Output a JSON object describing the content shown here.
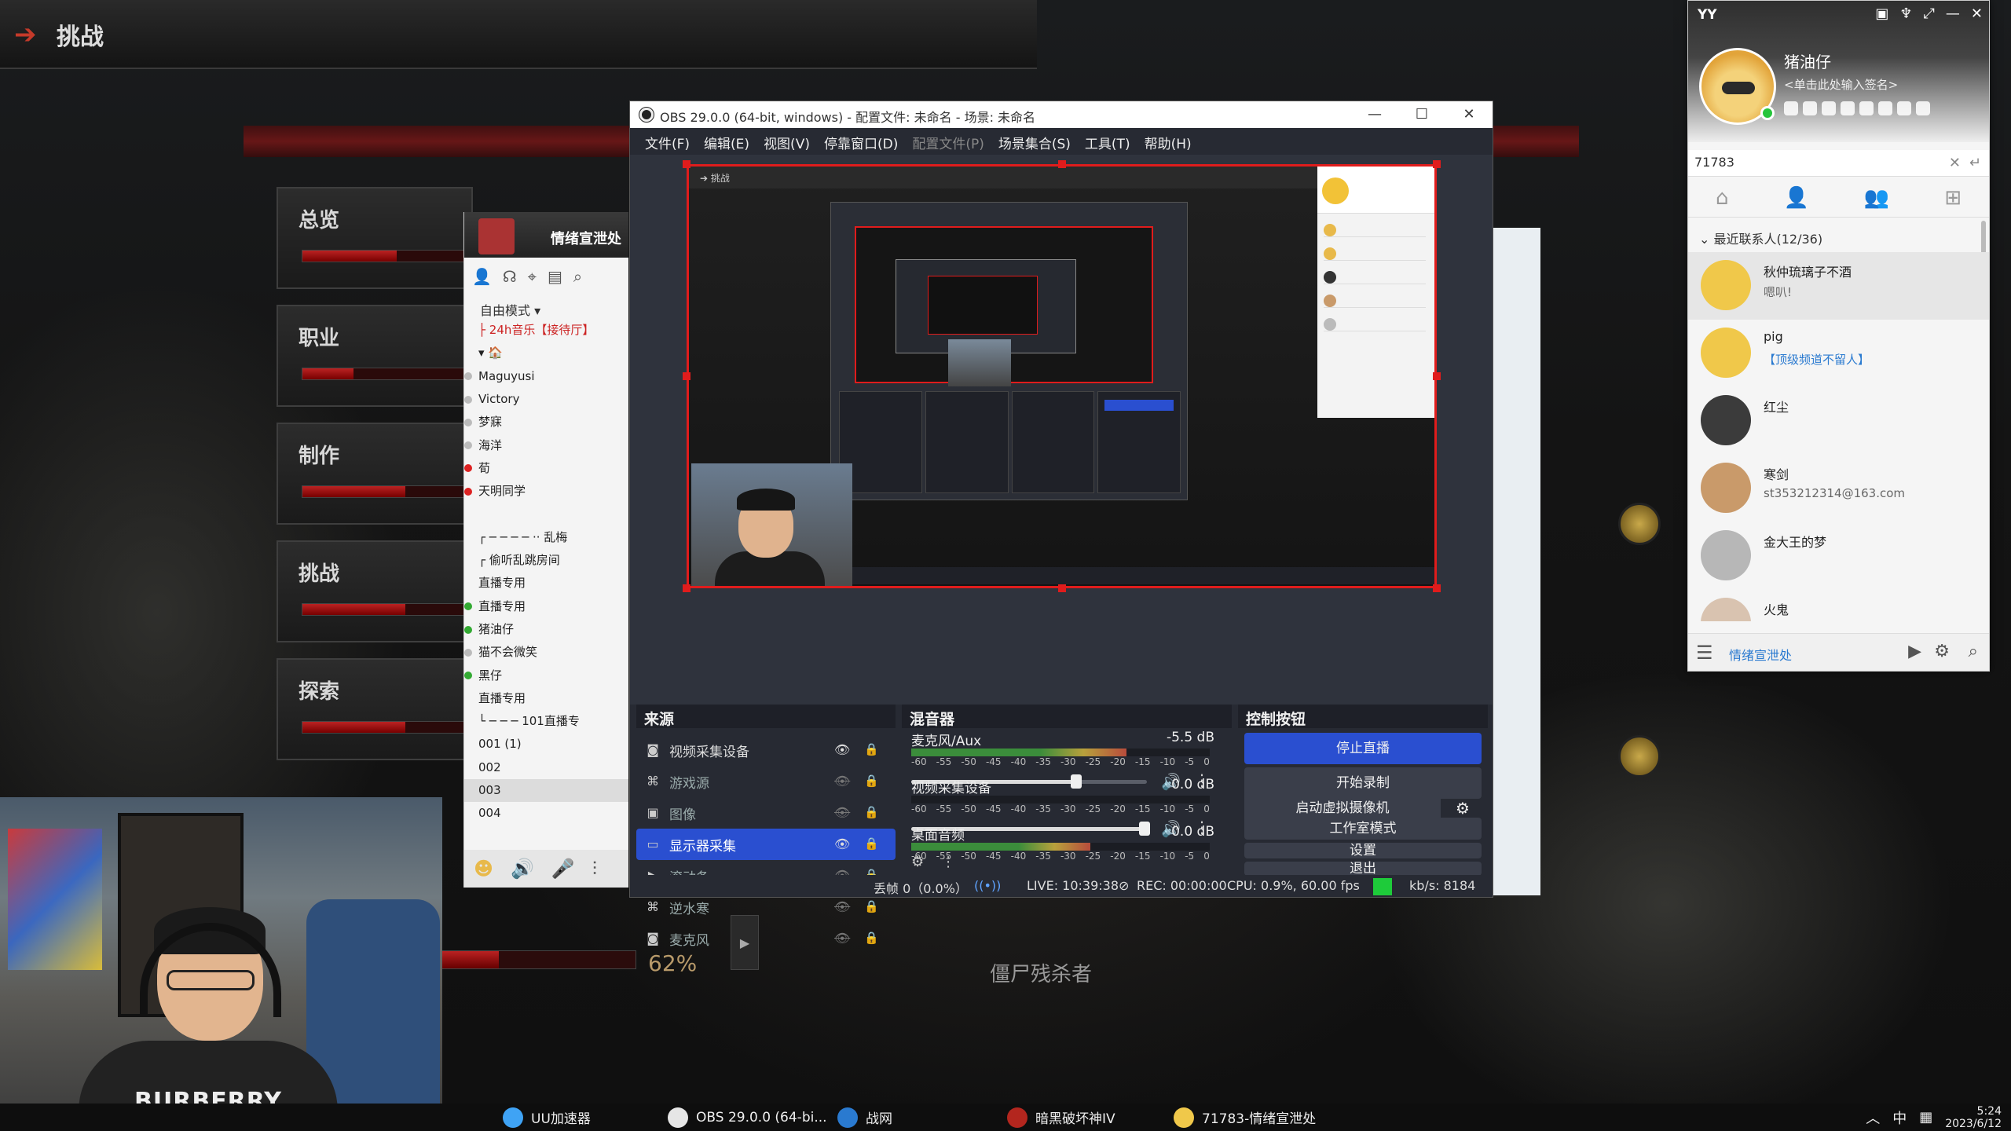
{
  "game": {
    "title": "挑战",
    "nav": [
      {
        "label": "总览",
        "progress": 0.55
      },
      {
        "label": "职业",
        "progress": 0.3
      },
      {
        "label": "制作",
        "progress": 0.6
      },
      {
        "label": "挑战",
        "progress": 0.6
      },
      {
        "label": "探索",
        "progress": 0.6
      }
    ],
    "progress_pct": "62%",
    "zombie_label": "僵尸残杀者"
  },
  "yy_channel": {
    "name": "情绪宣泄处",
    "mode": "自由模式 ▾",
    "items": [
      "├ 24h音乐【接待厅】",
      "▾ 🏠",
      "Maguyusi",
      "Victory",
      "梦寐",
      "海洋",
      "荀",
      "天明同学",
      "",
      "┌ ─ ─ ─ ─ ·· 乱梅",
      "┌ 偷听乱跳房间",
      "直播专用",
      "直播专用",
      "猪油仔",
      "猫不会微笑",
      "黑仔",
      "直播专用",
      "└ ─ ─ ─ 101直播专",
      "001 (1)",
      "002",
      "003",
      "004"
    ]
  },
  "webcam": {
    "shirt_text": "BURBERRY"
  },
  "obs": {
    "title": "OBS 29.0.0 (64-bit, windows) - 配置文件: 未命名 - 场景: 未命名",
    "menu": [
      "文件(F)",
      "编辑(E)",
      "视图(V)",
      "停靠窗口(D)",
      "配置文件(P)",
      "场景集合(S)",
      "工具(T)",
      "帮助(H)"
    ],
    "preview_header": "挑战",
    "sources_title": "来源",
    "sources": [
      {
        "icon": "camera-icon",
        "label": "视频采集设备",
        "visible": true
      },
      {
        "icon": "gamepad-icon",
        "label": "游戏源",
        "visible": false
      },
      {
        "icon": "image-icon",
        "label": "图像",
        "visible": false
      },
      {
        "icon": "monitor-icon",
        "label": "显示器采集",
        "visible": true,
        "selected": true
      },
      {
        "icon": "play-icon",
        "label": "滚动条",
        "visible": false
      },
      {
        "icon": "gamepad-icon",
        "label": "逆水寒",
        "visible": false
      },
      {
        "icon": "camera-icon",
        "label": "麦克风",
        "visible": false
      }
    ],
    "mixer_title": "混音器",
    "mixer_scale": [
      "-60",
      "-55",
      "-50",
      "-45",
      "-40",
      "-35",
      "-30",
      "-25",
      "-20",
      "-15",
      "-10",
      "-5",
      "0"
    ],
    "mixer": [
      {
        "name": "麦克风/Aux",
        "db": "-5.5 dB",
        "level": 0.72,
        "volume": 0.7
      },
      {
        "name": "视频采集设备",
        "db": "0.0 dB",
        "level": 0.0,
        "volume": 1.0
      },
      {
        "name": "桌面音频",
        "db": "0.0 dB",
        "level": 0.6,
        "volume": 1.0
      }
    ],
    "controls_title": "控制按钮",
    "controls": {
      "stop_stream": "停止直播",
      "start_record": "开始录制",
      "virtual_cam": "启动虚拟摄像机",
      "studio_mode": "工作室模式",
      "settings": "设置",
      "exit": "退出"
    },
    "status": {
      "dropped": "丢帧 0（0.0%）",
      "live": "LIVE: 10:39:38",
      "rec": "REC: 00:00:00",
      "cpu": "CPU: 0.9%, 60.00 fps",
      "kbps": "kb/s: 8184"
    }
  },
  "yy": {
    "app_title": "YY",
    "username": "猪油仔",
    "signature": "<单击此处输入签名>",
    "search_value": "71783",
    "group_label": "最近联系人(12/36)",
    "contacts": [
      {
        "name": "秋仲琉璃子不酒",
        "sub": "嗯叭!",
        "color": "#f0c84a"
      },
      {
        "name": "pig",
        "sub": "【顶级频道不留人】",
        "color": "#f0c84a",
        "blue": true
      },
      {
        "name": "红尘",
        "sub": "",
        "color": "#3b3b3b"
      },
      {
        "name": "寒剑",
        "sub": "st353212314@163.com",
        "color": "#c99a6a"
      },
      {
        "name": "金大王的梦",
        "sub": "",
        "color": "#b7b7b7"
      },
      {
        "name": "火鬼",
        "sub": "",
        "color": "#d9c3b0"
      }
    ],
    "bottom_label": "情绪宣泄处"
  },
  "taskbar": {
    "items": [
      {
        "label": "UU加速器",
        "color": "#3fa3f5"
      },
      {
        "label": "OBS 29.0.0 (64-bi...",
        "color": "#e6e6e6"
      },
      {
        "label": "战网",
        "color": "#2a7ad0"
      },
      {
        "label": "暗黑破坏神IV",
        "color": "#b3261e"
      },
      {
        "label": "71783-情绪宣泄处",
        "color": "#f0c84a"
      }
    ],
    "ime": "中",
    "time": "5:24",
    "date": "2023/6/12"
  }
}
